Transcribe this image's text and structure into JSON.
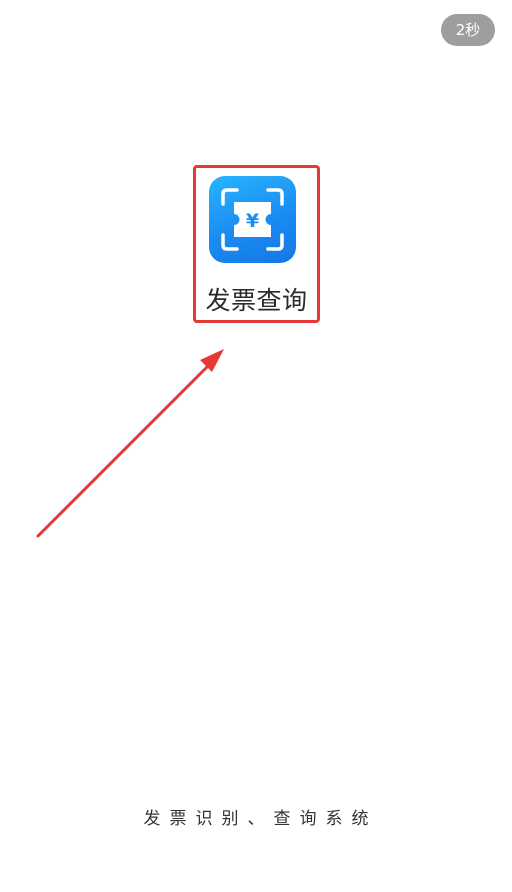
{
  "skip_button": {
    "label": "2秒"
  },
  "app": {
    "name": "发票查询",
    "icon": "invoice-scan-icon",
    "icon_glyph": "¥"
  },
  "footer": {
    "tagline": "发票识别、查询系统"
  },
  "colors": {
    "highlight": "#e53935",
    "arrow": "#e53935",
    "icon_gradient_start": "#28b4ff",
    "icon_gradient_end": "#1477e6",
    "skip_pill": "#9e9e9e"
  }
}
